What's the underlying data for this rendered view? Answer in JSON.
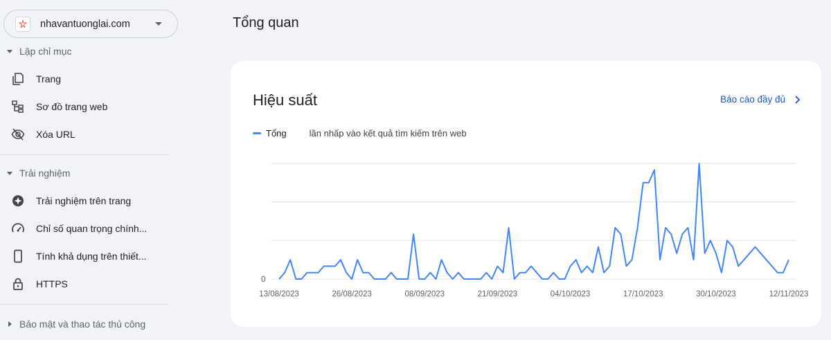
{
  "property": {
    "name": "nhavantuonglai.com"
  },
  "sidebar": {
    "sections": [
      {
        "title": "Lập chỉ mục"
      },
      {
        "title": "Trải nghiệm"
      },
      {
        "title": "Bảo mật và thao tác thủ công"
      }
    ],
    "indexing_items": [
      {
        "label": "Trang",
        "icon": "pages-icon"
      },
      {
        "label": "Sơ đồ trang web",
        "icon": "sitemap-icon"
      },
      {
        "label": "Xóa URL",
        "icon": "eye-off-icon"
      }
    ],
    "experience_items": [
      {
        "label": "Trải nghiệm trên trang",
        "icon": "page-experience-icon"
      },
      {
        "label": "Chỉ số quan trọng chính...",
        "icon": "speedometer-icon"
      },
      {
        "label": "Tính khả dụng trên thiết...",
        "icon": "smartphone-icon"
      },
      {
        "label": "HTTPS",
        "icon": "lock-icon"
      }
    ]
  },
  "main": {
    "title": "Tổng quan",
    "card": {
      "title": "Hiệu suất",
      "full_report": "Báo cáo đầy đủ",
      "legend": {
        "name": "Tổng",
        "description": "lần nhấp vào kết quả tìm kiếm trên web"
      }
    }
  },
  "colors": {
    "accent": "#1a56c4",
    "series": "#4285f4"
  },
  "chart_data": {
    "type": "line",
    "y_tick_labels": [
      "0"
    ],
    "ylim": [
      0,
      18
    ],
    "grid": true,
    "x_tick_labels": [
      "13/08/2023",
      "26/08/2023",
      "08/09/2023",
      "21/09/2023",
      "04/10/2023",
      "17/10/2023",
      "30/10/2023",
      "12/11/2023"
    ],
    "series": [
      {
        "values": [
          0,
          1,
          3,
          0,
          0,
          1,
          1,
          1,
          2,
          2,
          2,
          3,
          1,
          0,
          3,
          1,
          1,
          0,
          0,
          0,
          1,
          0,
          0,
          0,
          7,
          0,
          0,
          1,
          0,
          3,
          1,
          0,
          1,
          0,
          0,
          0,
          0,
          1,
          0,
          2,
          1,
          8,
          0,
          1,
          1,
          2,
          1,
          0,
          0,
          1,
          0,
          0,
          2,
          3,
          1,
          2,
          1,
          5,
          1,
          2,
          8,
          7,
          2,
          3,
          8,
          15,
          15,
          17,
          3,
          8,
          7,
          4,
          7,
          8,
          3,
          18,
          4,
          6,
          4,
          1,
          6,
          5,
          2,
          3,
          4,
          5,
          4,
          3,
          2,
          1,
          1,
          3
        ]
      }
    ]
  }
}
